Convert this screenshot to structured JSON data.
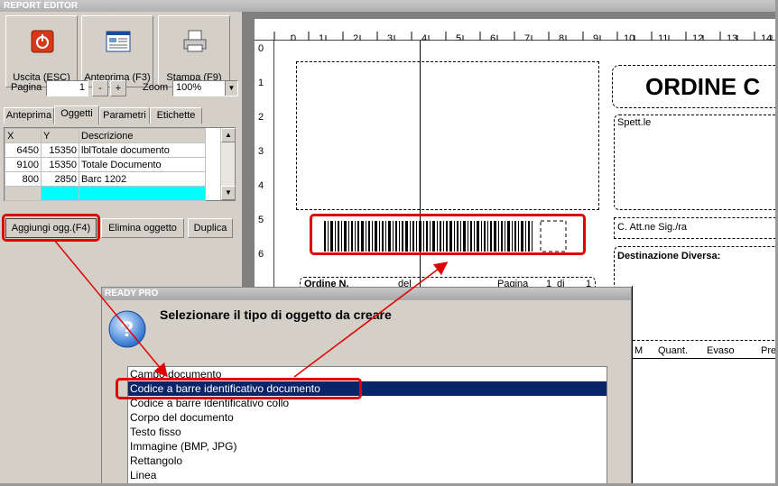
{
  "window": {
    "title": "REPORT EDITOR"
  },
  "toolbar": {
    "exit_label": "Uscita (ESC)",
    "preview_label": "Anteprima (F3)",
    "print_label": "Stampa (F9)"
  },
  "pager": {
    "page_label": "Pagina",
    "page_value": "1",
    "minus": "-",
    "plus": "+",
    "zoom_label": "Zoom",
    "zoom_value": "100%"
  },
  "tabs": [
    "Anteprima",
    "Oggetti",
    "Parametri",
    "Etichette"
  ],
  "object_table": {
    "headers": [
      "X",
      "Y",
      "Descrizione"
    ],
    "rows": [
      [
        "6450",
        "15350",
        "lblTotale documento"
      ],
      [
        "9100",
        "15350",
        "Totale Documento"
      ],
      [
        "800",
        "2850",
        "Barc 1202"
      ]
    ]
  },
  "actions": {
    "add_label": "Aggiungi ogg.(F4)",
    "delete_label": "Elimina oggetto",
    "duplicate_label": "Duplica"
  },
  "ruler": {
    "h_ticks": [
      "0",
      "1",
      "2",
      "3",
      "4",
      "5",
      "6",
      "7",
      "8",
      "9",
      "10",
      "11",
      "12",
      "13",
      "14"
    ],
    "v_ticks": [
      "0",
      "1",
      "2",
      "3",
      "4",
      "5",
      "6"
    ]
  },
  "report": {
    "order_title": "ORDINE C",
    "spett_label": "Spett.le",
    "att_label": "C. Att.ne Sig./ra",
    "dest_label": "Destinazione Diversa:",
    "ordine_label": "Ordine N.",
    "del_label": "del",
    "pagina_label": "Pagina",
    "page_num": "1",
    "di_label": "di",
    "page_total": "1",
    "col_m": "M",
    "col_quant": "Quant.",
    "col_evaso": "Evaso",
    "col_pre": "Pre"
  },
  "dialog": {
    "title": "READY PRO",
    "message": "Selezionare il tipo di oggetto da creare",
    "items": [
      "Campo documento",
      "Codice a barre identificativo documento",
      "Codice a barre identificativo collo",
      "Corpo del documento",
      "Testo fisso",
      "Immagine (BMP, JPG)",
      "Rettangolo",
      "Linea"
    ],
    "selected_index": 1
  },
  "colors": {
    "annotation": "#e00000",
    "selection": "#0a246a",
    "cyan_row": "#00ffff"
  }
}
